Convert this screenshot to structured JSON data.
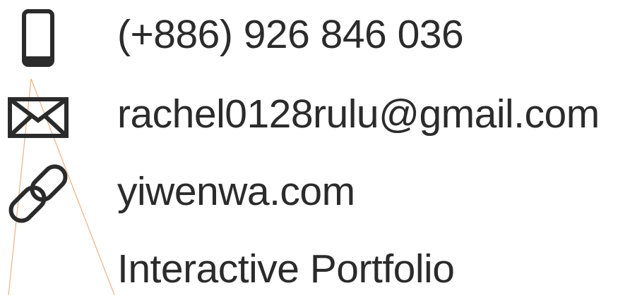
{
  "contact": {
    "phone": "(+886) 926 846 036",
    "email": "rachel0128rulu@gmail.com",
    "website": "yiwenwa.com",
    "portfolio": "Interactive Portfolio"
  },
  "icons": {
    "phone": "phone-icon",
    "email": "envelope-icon",
    "website": "link-icon"
  },
  "colors": {
    "text": "#2b2b2b",
    "icon": "#2b2b2b",
    "accent_line": "#f0b080",
    "background": "#ffffff"
  }
}
